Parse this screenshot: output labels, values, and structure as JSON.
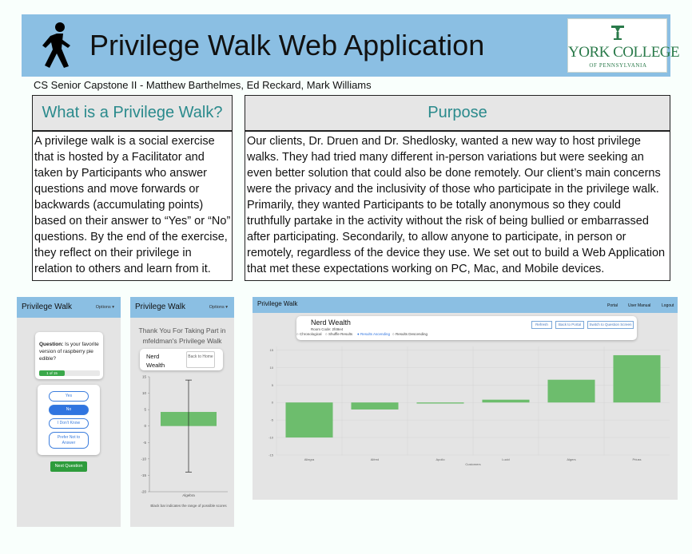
{
  "poster": {
    "title": "Privilege Walk Web Application",
    "authors": "CS Senior Capstone II - Matthew Barthelmes, Ed Reckard, Mark Williams",
    "logo": {
      "name": "YORK COLLEGE",
      "sub": "OF PENNSYLVANIA",
      "color": "#2a7a4a"
    },
    "colors": {
      "banner": "#8bbfe3",
      "heading": "#2a8a8c",
      "bar": "#6dbd6d"
    }
  },
  "sections": {
    "what": {
      "heading": "What is a Privilege Walk?",
      "lines": [
        "A privilege walk is a social exercise",
        "that is hosted by a Facilitator and",
        "taken by Participants who answer",
        "questions and move forwards or",
        "backwards (accumulating points)",
        "based on their answer to “Yes” or “No”",
        "questions. By the end of the exercise,",
        "they reflect on their privilege in",
        "relation to others and learn from it."
      ]
    },
    "purpose": {
      "heading": "Purpose",
      "lines": [
        "Our clients, Dr. Druen and Dr. Shedlosky, wanted a new way to host privilege",
        "walks. They had tried many different in-person variations but were seeking an",
        "even better solution that could also be done remotely.  Our client’s main concerns",
        "were the privacy and the inclusivity of those who participate in the privilege walk.",
        "Primarily, they wanted Participants to be totally anonymous so they could",
        "truthfully partake in the activity without the risk of being bullied or embarrassed",
        "after participating. Secondarily, to allow anyone to participate, in person or",
        "remotely, regardless of the device they use. We set out to build a Web Application",
        "that met these expectations working on PC, Mac, and Mobile devices."
      ]
    }
  },
  "screens": {
    "question": {
      "brand": "Privilege Walk",
      "options": "Options ▾",
      "question_label": "Question:",
      "question_text": "Is your favorite version of raspberry pie edible?",
      "progress_label": "1 of 15",
      "progress_fraction": 0.42,
      "answers": [
        "Yes",
        "No",
        "I Don't Know",
        "Prefer Not to Answer"
      ],
      "selected": "No",
      "next": "Next Question"
    },
    "result": {
      "brand": "Privilege Walk",
      "options": "Options ▾",
      "thanks": "Thank You For Taking Part in mfeldman's Privilege Walk",
      "category": "Nerd Wealth",
      "back": "Back to Home",
      "chart_caption": "Black bar indicates the range of possible scores"
    },
    "host": {
      "brand": "Privilege Walk",
      "nav": [
        "Portal",
        "User Manual",
        "Logout"
      ],
      "title": "Nerd Wealth",
      "room": "Room Code: 2f48e4",
      "buttons": [
        "Refresh",
        "Back to Portal",
        "Switch to Question Screen"
      ],
      "radios": [
        "Chronological",
        "Shuffle Results",
        "Results Ascending",
        "Results Descending"
      ],
      "selected_radio": "Results Ascending"
    }
  },
  "chart_data": [
    {
      "type": "bar",
      "categories": [
        "Algebra"
      ],
      "values": [
        4.3
      ],
      "ylim": [
        -20,
        15
      ],
      "error_range": [
        -14,
        14
      ],
      "caption": "Black bar indicates the range of possible scores"
    },
    {
      "type": "bar",
      "categories": [
        "Allegra",
        "Alfred",
        "Apollo",
        "Lucid",
        "Algers",
        "Priuss"
      ],
      "values": [
        -10,
        -2,
        -0.3,
        0.8,
        6.5,
        13.5
      ],
      "xlabel": "Customers",
      "ylim": [
        -15,
        16
      ],
      "grid": true
    }
  ]
}
